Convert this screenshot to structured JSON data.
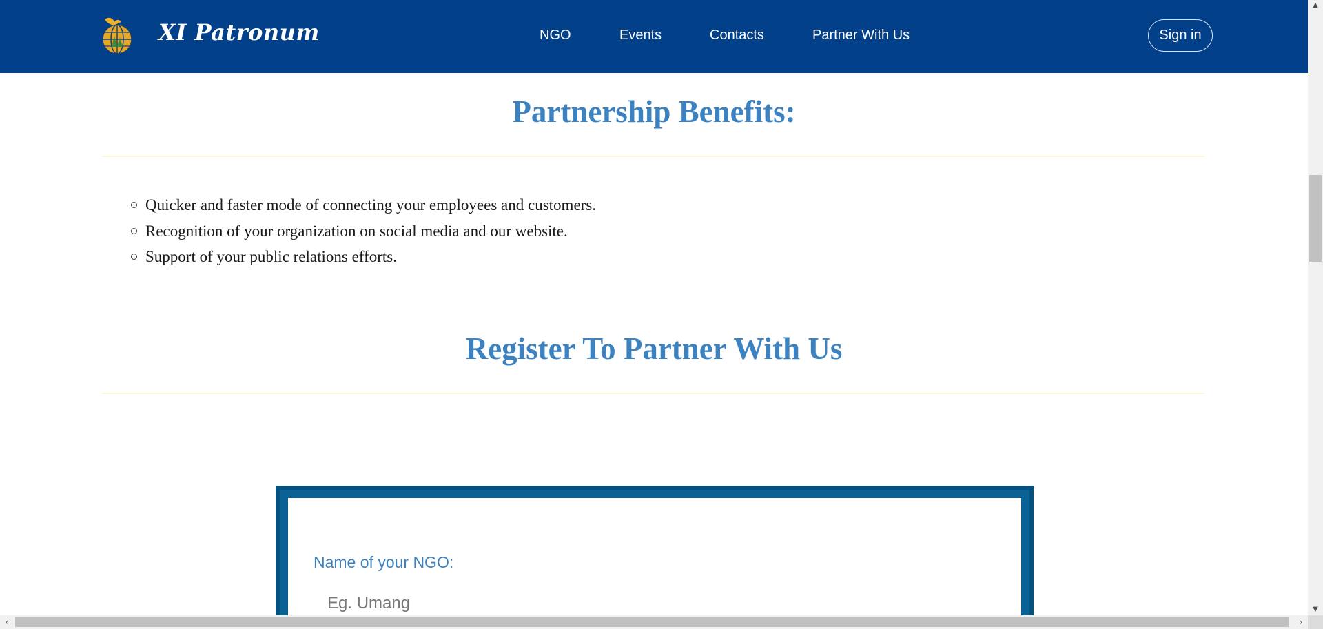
{
  "header": {
    "brand": "XI Patronum",
    "logo_icon": "globe-bird-logo-icon",
    "nav": [
      "NGO",
      "Events",
      "Contacts",
      "Partner With Us"
    ],
    "signin_label": "Sign in",
    "colors": {
      "navbar": "#03408a",
      "accent": "#3c82c0"
    }
  },
  "benefits": {
    "title": "Partnership Benefits:",
    "items": [
      "Quicker and faster mode of connecting your employees and customers.",
      "Recognition of your organization on social media and our website.",
      "Support of your public relations efforts."
    ]
  },
  "register": {
    "title": "Register To Partner With Us",
    "form": {
      "ngo_name_label": "Name of your NGO:",
      "ngo_name_placeholder": "Eg. Umang",
      "ngo_name_value": ""
    }
  },
  "scrollbars": {
    "arrow_up": "▲",
    "arrow_down": "▼",
    "arrow_left": "‹",
    "arrow_right": "›"
  }
}
